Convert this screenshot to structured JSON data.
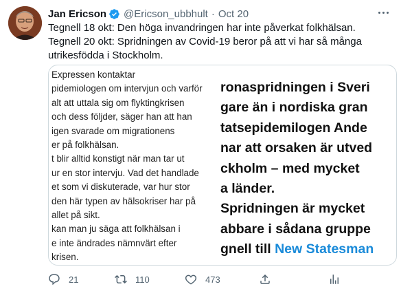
{
  "tweet": {
    "author_name": "Jan Ericson",
    "handle": "@Ericson_ubbhult",
    "separator": "·",
    "date": "Oct 20",
    "verified_color": "#1d9bf0",
    "text_lines": [
      "Tegnell 18 okt: Den höga invandringen har inte påverkat folkhälsan.",
      "Tegnell 20 okt: Spridningen av Covid-19 beror på att vi har så många utrikesfödda i Stockholm."
    ]
  },
  "media": {
    "left_lines": [
      "Expressen kontaktar",
      "pidemiologen om intervjun och varför",
      "alt att uttala sig om flyktingkrisen",
      "och dess följder, säger han att han",
      "igen svarade om migrationens",
      "er på folkhälsan.",
      "t blir alltid konstigt när man tar ut",
      "ur en stor intervju. Vad det handlade",
      "et som vi diskuterade, var hur stor",
      "den här typen av hälsokriser har på",
      "allet på sikt.",
      "kan man ju säga att folkhälsan i",
      "e inte ändrades nämnvärt efter",
      "krisen."
    ],
    "right_lines": [
      "ronaspridningen i Sveri",
      "gare än i nordiska gran",
      "tatsepidemilogen Ande",
      "nar att orsaken är utved",
      "ckholm – med mycket",
      "a länder.",
      "Spridningen är mycket",
      "abbare i sådana gruppe",
      "gnell till "
    ],
    "right_accent": "New Statesman",
    "accent_color": "#1b8bd9"
  },
  "actions": {
    "reply_count": "21",
    "retweet_count": "110",
    "like_count": "473",
    "icons": [
      "reply-icon",
      "retweet-icon",
      "like-icon",
      "share-icon",
      "analytics-icon"
    ]
  }
}
